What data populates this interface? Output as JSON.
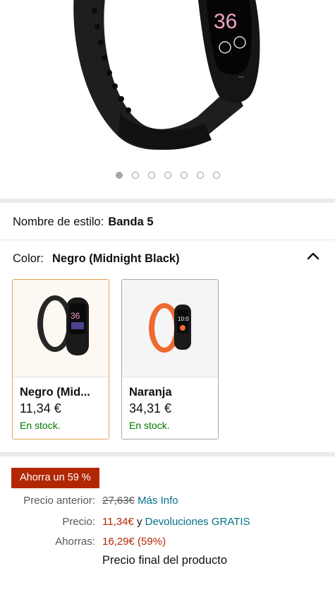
{
  "carousel": {
    "count": 7,
    "active_index": 0
  },
  "style": {
    "label": "Nombre de estilo:",
    "value": "Banda 5"
  },
  "color": {
    "label": "Color:",
    "value": "Negro (Midnight Black)"
  },
  "swatches": [
    {
      "name": "Negro (Mid...",
      "price": "11,34 €",
      "stock": "En stock.",
      "band_color": "#2b2b2b"
    },
    {
      "name": "Naranja",
      "price": "34,31 €",
      "stock": "En stock.",
      "band_color": "#ef6a2e"
    }
  ],
  "deal": {
    "badge": "Ahorra un 59 %"
  },
  "pricing": {
    "previous_label": "Precio anterior:",
    "previous_value": "27,63€",
    "more_info": "Más Info",
    "price_label": "Precio:",
    "price_value": "11,34€",
    "price_connector": "y",
    "returns_link": "Devoluciones GRATIS",
    "savings_label": "Ahorras:",
    "savings_value": "16,29€ (59%)",
    "final_note": "Precio final del producto"
  }
}
